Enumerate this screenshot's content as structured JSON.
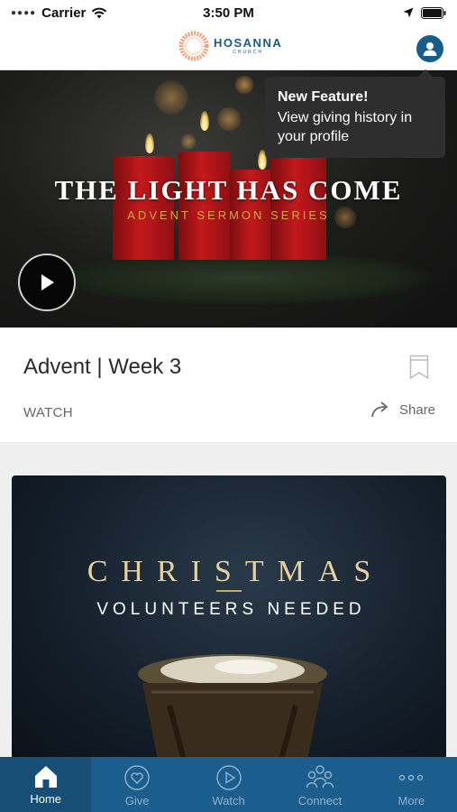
{
  "status_bar": {
    "carrier": "Carrier",
    "time": "3:50 PM"
  },
  "header": {
    "logo_name": "HOSANNA",
    "logo_sub": "CHURCH"
  },
  "tooltip": {
    "title": "New Feature!",
    "body": "View giving history in your profile"
  },
  "hero": {
    "title": "THE LIGHT HAS COME",
    "subtitle": "ADVENT SERMON SERIES"
  },
  "card": {
    "title": "Advent | Week 3",
    "type_label": "WATCH",
    "share_label": "Share"
  },
  "promo": {
    "title": "CHRISTMAS",
    "subtitle": "VOLUNTEERS NEEDED"
  },
  "tabs": [
    {
      "label": "Home",
      "icon": "home-icon",
      "active": true
    },
    {
      "label": "Give",
      "icon": "heart-circle-icon",
      "active": false
    },
    {
      "label": "Watch",
      "icon": "play-circle-icon",
      "active": false
    },
    {
      "label": "Connect",
      "icon": "people-icon",
      "active": false
    },
    {
      "label": "More",
      "icon": "ellipsis-icon",
      "active": false
    }
  ],
  "colors": {
    "brand": "#1b5e8d",
    "accent_gold": "#d9a53c",
    "tooltip_bg": "#2e2e2e"
  }
}
